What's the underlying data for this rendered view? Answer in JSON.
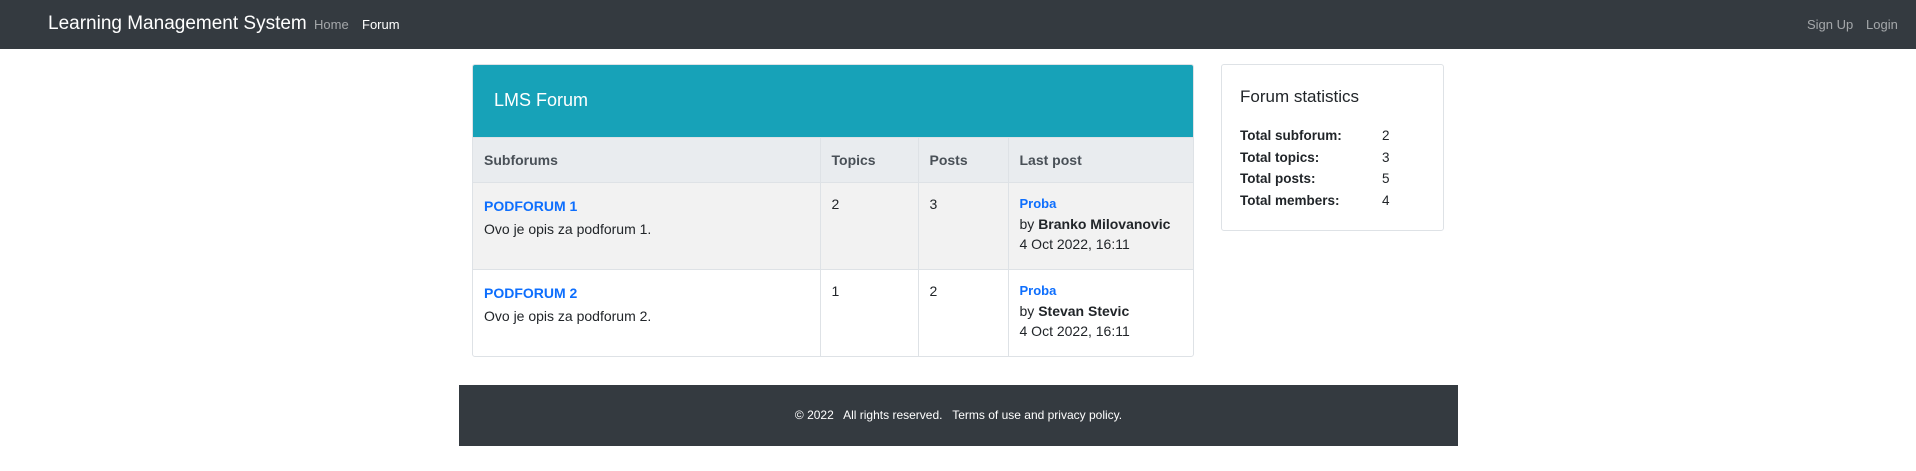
{
  "navbar": {
    "brand": "Learning Management System",
    "links": {
      "home": "Home",
      "forum": "Forum",
      "signup": "Sign Up",
      "login": "Login"
    },
    "colors": {
      "background": "#343a40"
    }
  },
  "forum": {
    "title": "LMS Forum",
    "header_color": "#17a2b8",
    "columns": {
      "subforums": "Subforums",
      "topics": "Topics",
      "posts": "Posts",
      "last_post": "Last post"
    },
    "rows": [
      {
        "name": "PODFORUM 1",
        "description": "Ovo je opis za podforum 1.",
        "topics": "2",
        "posts": "3",
        "last_post": {
          "title": "Proba",
          "by": "by ",
          "author": "Branko Milovanovic",
          "date": "4 Oct 2022, 16:11"
        }
      },
      {
        "name": "PODFORUM 2",
        "description": "Ovo je opis za podforum 2.",
        "topics": "1",
        "posts": "2",
        "last_post": {
          "title": "Proba",
          "by": "by ",
          "author": "Stevan Stevic",
          "date": "4 Oct 2022, 16:11"
        }
      }
    ]
  },
  "stats": {
    "title": "Forum statistics",
    "items": [
      {
        "label": "Total subforum:",
        "value": "2"
      },
      {
        "label": "Total topics:",
        "value": "3"
      },
      {
        "label": "Total posts:",
        "value": "5"
      },
      {
        "label": "Total members:",
        "value": "4"
      }
    ]
  },
  "footer": {
    "text": "© 2022   All rights reserved.   Terms of use and privacy policy."
  }
}
